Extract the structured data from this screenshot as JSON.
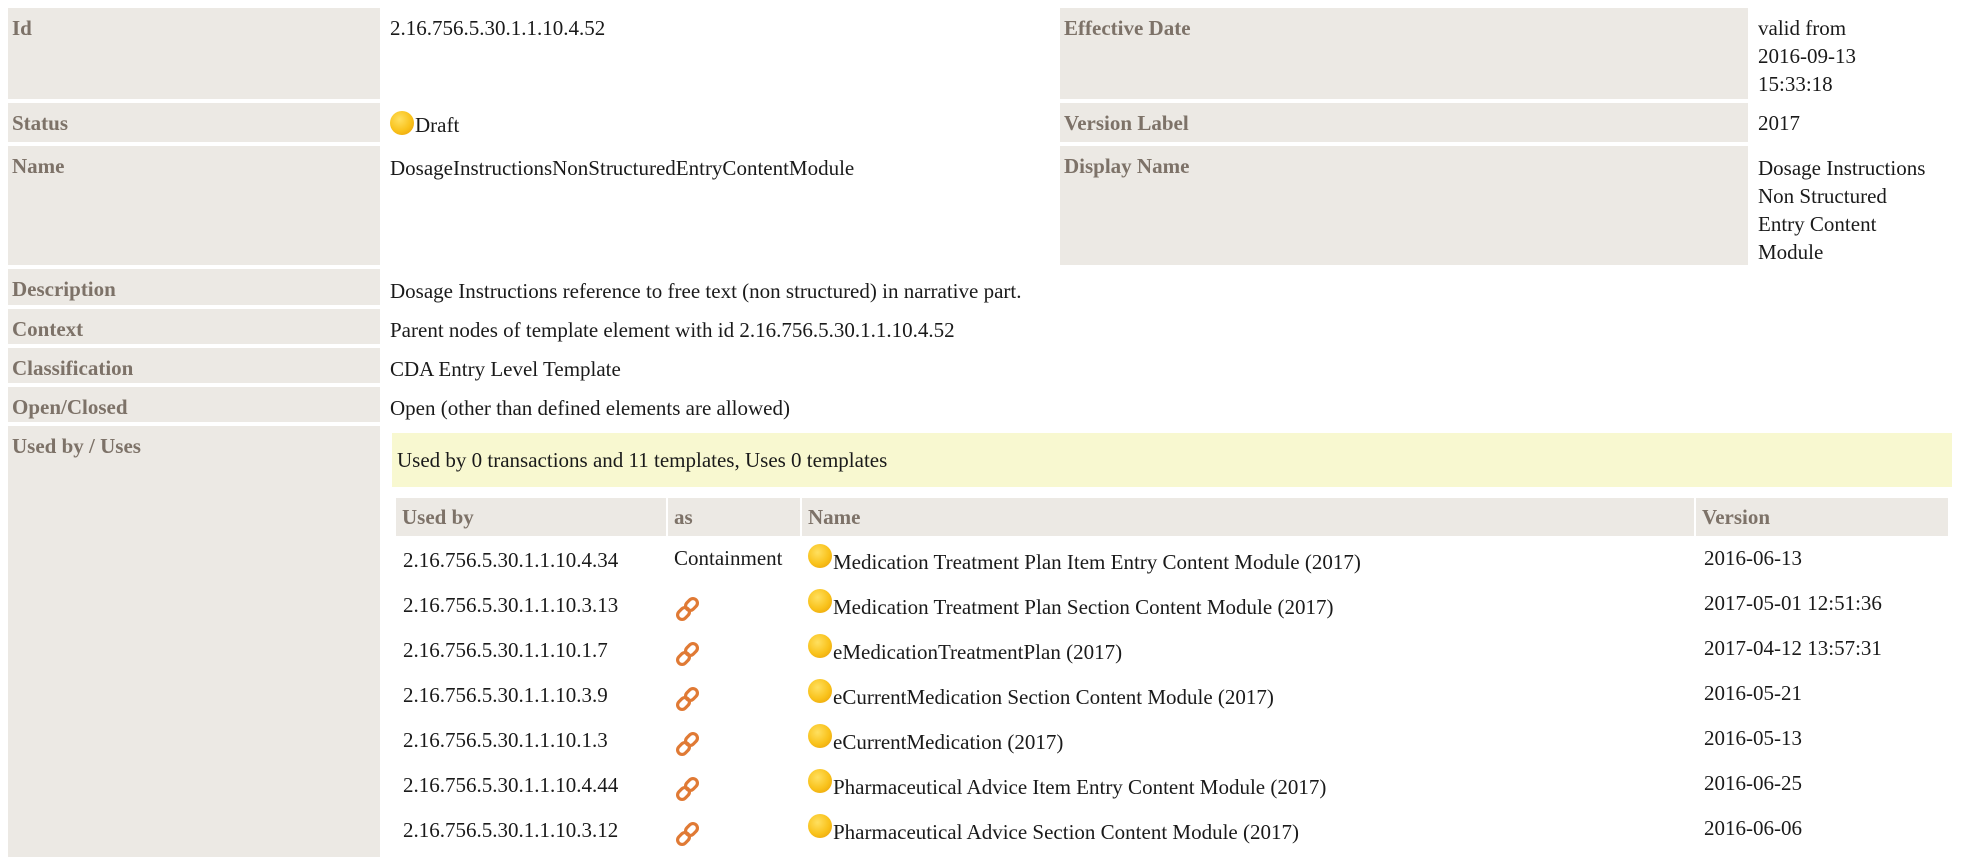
{
  "labels": {
    "id": "Id",
    "effective_date": "Effective Date",
    "status": "Status",
    "version_label": "Version Label",
    "name": "Name",
    "display_name": "Display Name",
    "description": "Description",
    "context": "Context",
    "classification": "Classification",
    "open_closed": "Open/Closed",
    "used_by_uses": "Used by / Uses"
  },
  "values": {
    "id": "2.16.756.5.30.1.1.10.4.52",
    "effective_date_lines": [
      "valid from",
      "2016-09-13",
      "15:33:18"
    ],
    "status": "Draft",
    "version_label": "2017",
    "name": "DosageInstructionsNonStructuredEntryContentModule",
    "display_name_lines": [
      "Dosage Instructions",
      "Non Structured",
      "Entry Content",
      "Module"
    ],
    "description": "Dosage Instructions reference to free text (non structured) in narrative part.",
    "context": "Parent nodes of template element with id 2.16.756.5.30.1.1.10.4.52",
    "classification": "CDA Entry Level Template",
    "open_closed": "Open (other than defined elements are allowed)"
  },
  "usage": {
    "summary": "Used by 0 transactions and 11 templates, Uses 0 templates",
    "columns": {
      "used_by": "Used by",
      "as": "as",
      "name": "Name",
      "version": "Version"
    },
    "rows": [
      {
        "used_by": "2.16.756.5.30.1.1.10.4.34",
        "as": "Containment",
        "as_icon": null,
        "name": "Medication Treatment Plan Item Entry Content Module (2017)",
        "version": "2016-06-13"
      },
      {
        "used_by": "2.16.756.5.30.1.1.10.3.13",
        "as": "",
        "as_icon": "link-icon",
        "name": "Medication Treatment Plan Section Content Module (2017)",
        "version": "2017-05-01 12:51:36"
      },
      {
        "used_by": "2.16.756.5.30.1.1.10.1.7",
        "as": "",
        "as_icon": "link-icon",
        "name": "eMedicationTreatmentPlan (2017)",
        "version": "2017-04-12 13:57:31"
      },
      {
        "used_by": "2.16.756.5.30.1.1.10.3.9",
        "as": "",
        "as_icon": "link-icon",
        "name": "eCurrentMedication Section Content Module (2017)",
        "version": "2016-05-21"
      },
      {
        "used_by": "2.16.756.5.30.1.1.10.1.3",
        "as": "",
        "as_icon": "link-icon",
        "name": "eCurrentMedication (2017)",
        "version": "2016-05-13"
      },
      {
        "used_by": "2.16.756.5.30.1.1.10.4.44",
        "as": "",
        "as_icon": "link-icon",
        "name": "Pharmaceutical Advice Item Entry Content Module (2017)",
        "version": "2016-06-25"
      },
      {
        "used_by": "2.16.756.5.30.1.1.10.3.12",
        "as": "",
        "as_icon": "link-icon",
        "name": "Pharmaceutical Advice Section Content Module (2017)",
        "version": "2016-06-06"
      }
    ]
  },
  "colors": {
    "label_bg": "#ece9e4",
    "label_text": "#7d7268",
    "banner_bg": "#f8f8d0",
    "status_draft": "#f9c21b",
    "link_icon": "#e07a35"
  },
  "icons": {
    "status": "status-draft-icon",
    "relation": "link-icon"
  }
}
